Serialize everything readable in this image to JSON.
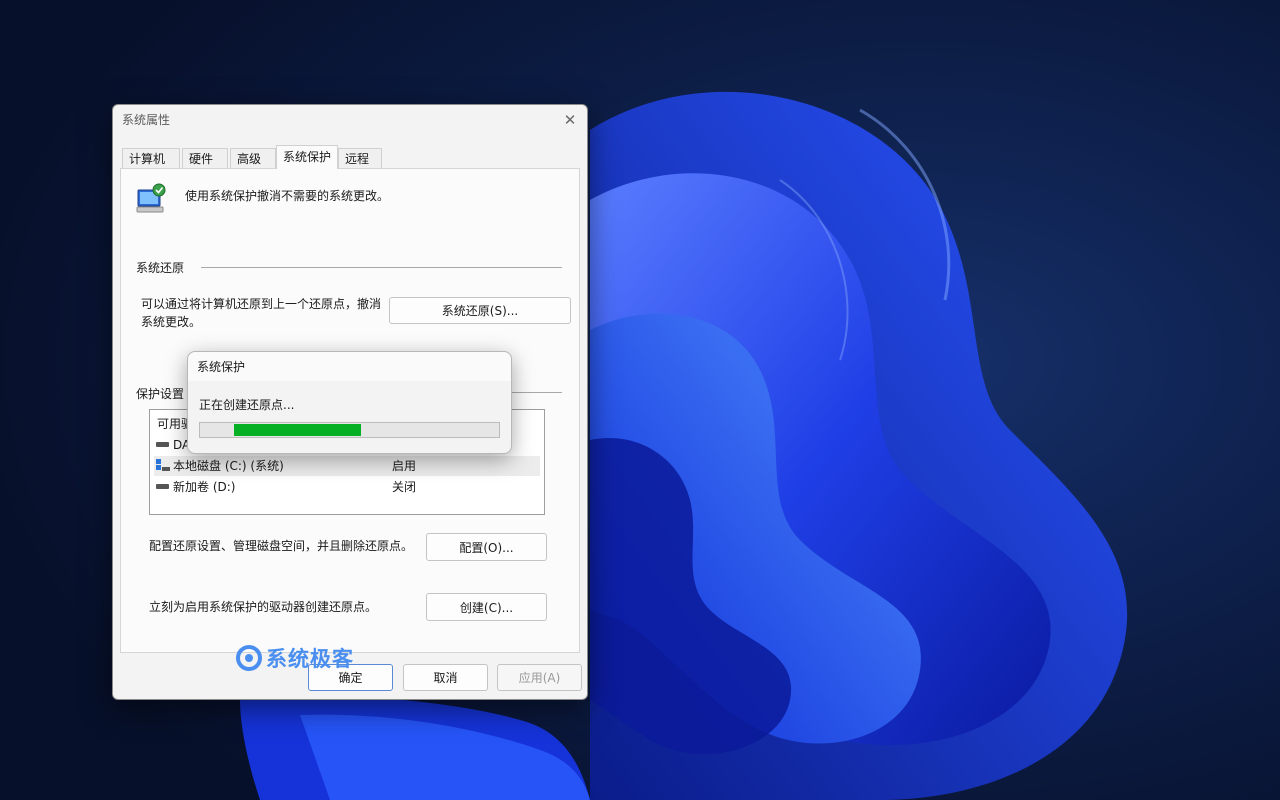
{
  "dialog": {
    "title": "系统属性",
    "close_glyph": "✕",
    "tabs": [
      "计算机名",
      "硬件",
      "高级",
      "系统保护",
      "远程"
    ],
    "active_tab": "系统保护",
    "description": "使用系统保护撤消不需要的系统更改。",
    "restore_section_label": "系统还原",
    "restore_text_line1": "可以通过将计算机还原到上一个还原点，撤消",
    "restore_text_line2": "系统更改。",
    "restore_button": "系统还原(S)...",
    "protection_section_label": "保护设置",
    "drive_list_header_partial": "可用驱",
    "drives": [
      {
        "name": "DA",
        "status": "",
        "icon": "drive-icon"
      },
      {
        "name": "本地磁盘 (C:) (系统)",
        "status": "启用",
        "icon": "windows-drive-icon"
      },
      {
        "name": "新加卷 (D:)",
        "status": "关闭",
        "icon": "drive-icon"
      }
    ],
    "configure_text": "配置还原设置、管理磁盘空间，并且删除还原点。",
    "configure_button": "配置(O)...",
    "create_text": "立刻为启用系统保护的驱动器创建还原点。",
    "create_button": "创建(C)...",
    "ok_button": "确定",
    "cancel_button": "取消",
    "apply_button": "应用(A)"
  },
  "progress_dialog": {
    "title": "系统保护",
    "message": "正在创建还原点...",
    "indeterminate": true,
    "color": "#06b025"
  },
  "watermark": {
    "text": "系统极客",
    "color": "#4a8ff0"
  },
  "colors": {
    "wallpaper_dark": "#0a1430",
    "wallpaper_accent": "#1e3cff"
  }
}
